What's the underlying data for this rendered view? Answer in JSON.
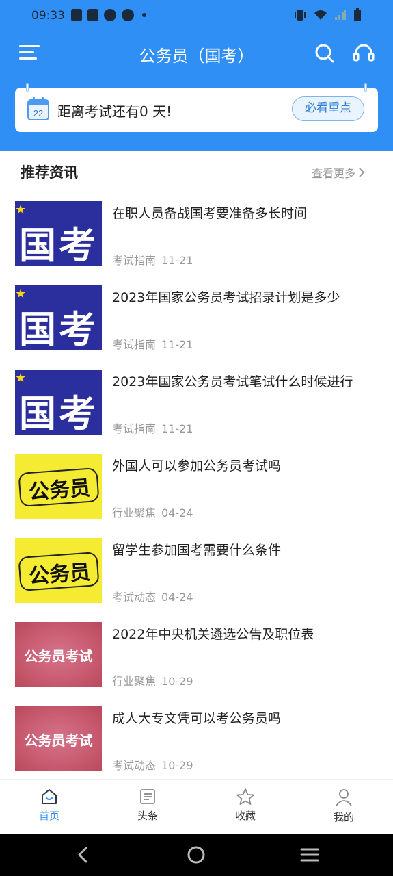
{
  "status_bar": {
    "time": "09:33"
  },
  "header": {
    "title": "公务员（国考）"
  },
  "countdown": {
    "calendar_day": "22",
    "text": "距离考试还有0 天!",
    "button": "必看重点"
  },
  "section": {
    "title": "推荐资讯",
    "more": "查看更多"
  },
  "news": [
    {
      "thumb": "国考",
      "title": "在职人员备战国考要准备多长时间",
      "category": "考试指南",
      "date": "11-21"
    },
    {
      "thumb": "国考",
      "title": "2023年国家公务员考试招录计划是多少",
      "category": "考试指南",
      "date": "11-21"
    },
    {
      "thumb": "国考",
      "title": "2023年国家公务员考试笔试什么时候进行",
      "category": "考试指南",
      "date": "11-21"
    },
    {
      "thumb": "公务员",
      "title": "外国人可以参加公务员考试吗",
      "category": "行业聚焦",
      "date": "04-24"
    },
    {
      "thumb": "公务员",
      "title": "留学生参加国考需要什么条件",
      "category": "考试动态",
      "date": "04-24"
    },
    {
      "thumb": "公务员考试",
      "title": "2022年中央机关遴选公告及职位表",
      "category": "行业聚焦",
      "date": "10-29"
    },
    {
      "thumb": "公务员考试",
      "title": "成人大专文凭可以考公务员吗",
      "category": "考试动态",
      "date": "10-29"
    }
  ],
  "tabs": [
    {
      "label": "首页",
      "icon": "home-icon",
      "active": true
    },
    {
      "label": "头条",
      "icon": "news-icon"
    },
    {
      "label": "收藏",
      "icon": "star-icon"
    },
    {
      "label": "我的",
      "icon": "user-icon"
    }
  ],
  "colors": {
    "primary": "#2f8ff5",
    "meta": "#999999"
  }
}
